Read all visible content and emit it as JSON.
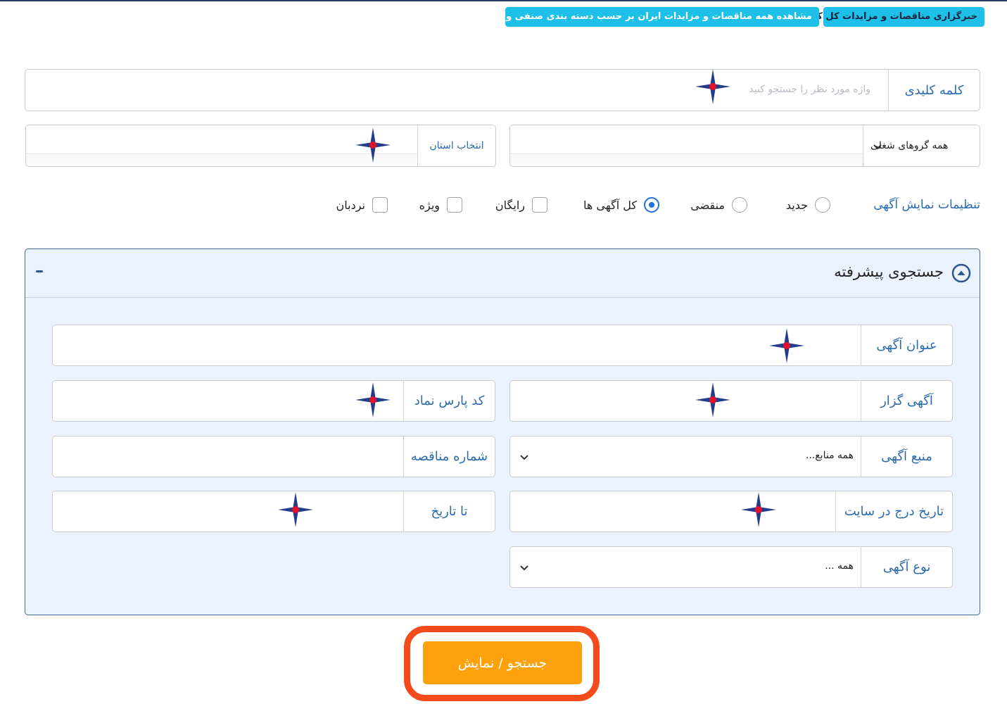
{
  "header": {
    "badge_news": "خبرگزاری مناقصات و مزایدات کل کشور",
    "badge_view_all": "مشاهده همه مناقصات و مزایدات ایران بر حسب دسته بندی صنفی و تخصصی"
  },
  "search": {
    "keyword_label": "کلمه کلیدی",
    "keyword_placeholder": "واژه مورد نظر  را جستجو کنید",
    "job_groups_value": "همه گروهای شغلی",
    "province_label": "انتخاب استان"
  },
  "display_settings": {
    "title": "تنظیمات نمایش آگهی",
    "options": [
      {
        "label": "جدید",
        "type": "radio",
        "checked": false
      },
      {
        "label": "منقضی",
        "type": "radio",
        "checked": false
      },
      {
        "label": "کل آگهی ها",
        "type": "radio",
        "checked": true
      },
      {
        "label": "رایگان",
        "type": "checkbox",
        "checked": false
      },
      {
        "label": "ویژه",
        "type": "checkbox",
        "checked": false
      },
      {
        "label": "نردبان",
        "type": "checkbox",
        "checked": false
      }
    ]
  },
  "advanced": {
    "title": "جستجوی پیشرفته",
    "collapse_symbol": "–",
    "ad_title_label": "عنوان آگهی",
    "advertiser_label": "آگهی گزار",
    "pars_code_label": "کد پارس نماد",
    "ad_source_label": "منبع آگهی",
    "ad_source_value": "همه منابع...",
    "tender_number_label": "شماره مناقصه",
    "date_posted_label": "تاریخ درج در سایت",
    "to_date_label": "تا تاریخ",
    "ad_type_label": "نوع آگهی",
    "ad_type_value": "همه ..."
  },
  "submit": {
    "label": "جستجو / نمایش"
  },
  "colors": {
    "label_blue": "#2c6bad",
    "panel_bg": "#eaf3fd",
    "badge_cyan": "#1ec0e8",
    "button_orange": "#fda20c",
    "highlight_red": "#f34b1c",
    "radio_blue": "#1f6fe5"
  }
}
